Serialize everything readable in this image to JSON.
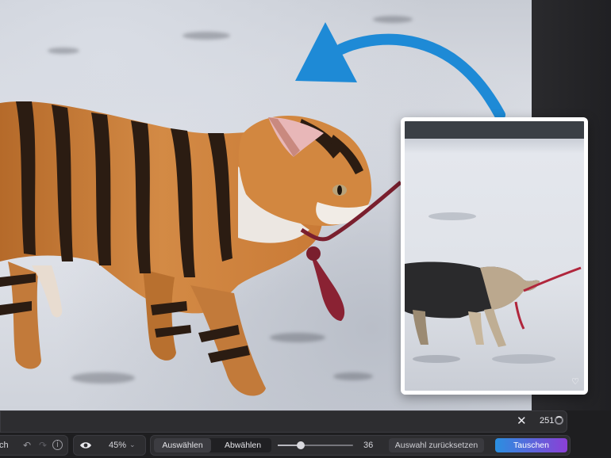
{
  "inset": {
    "heart_icon": "heart-icon"
  },
  "statusbar": {
    "close_icon": "close-icon",
    "count": "251"
  },
  "toolbar": {
    "left_partial_label": "ch",
    "undo_icon": "undo-icon",
    "redo_icon": "redo-icon",
    "info_icon": "info-icon",
    "eye_icon": "eye-icon",
    "zoom_value": "45%",
    "zoom_chevron": "chevron-down-icon",
    "select_label": "Auswählen",
    "deselect_label": "Abwählen",
    "brush_size_value": "36",
    "brush_size_fraction": 0.31,
    "reset_selection_label": "Auswahl zurücksetzen",
    "swap_label": "Tauschen"
  },
  "colors": {
    "arrow": "#1e8ad6",
    "swap_gradient_start": "#2a8fe0",
    "swap_gradient_end": "#8b3fd6",
    "panel": "#2d2d30"
  }
}
